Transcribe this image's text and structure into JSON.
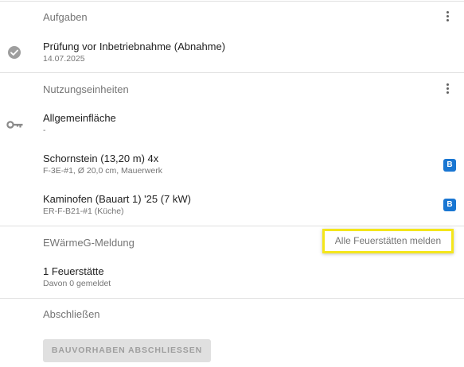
{
  "tasks": {
    "title": "Aufgaben",
    "item": {
      "title": "Prüfung vor Inbetriebnahme (Abnahme)",
      "date": "14.07.2025"
    }
  },
  "units": {
    "title": "Nutzungseinheiten",
    "area": {
      "title": "Allgemeinfläche",
      "subtitle": "-"
    },
    "items": [
      {
        "title": "Schornstein (13,20 m) 4x",
        "subtitle": "F-3E-#1, Ø 20,0 cm, Mauerwerk",
        "badge": "B"
      },
      {
        "title": "Kaminofen (Bauart 1) '25 (7 kW)",
        "subtitle": "ER-F-B21-#1 (Küche)",
        "badge": "B"
      }
    ]
  },
  "ewaermeg": {
    "title": "EWärmeG-Meldung",
    "report_all_label": "Alle Feuerstätten melden",
    "count_label": "1 Feuerstätte",
    "reported_label": "Davon 0 gemeldet"
  },
  "finish": {
    "title": "Abschließen",
    "button_label": "BAUVORHABEN ABSCHLIESSEN"
  },
  "colors": {
    "badge": "#1976d2",
    "highlight": "#f4e61b",
    "divider": "#e0e0e0"
  },
  "icons": {
    "task_status": "check-circle-icon",
    "units": "key-icon",
    "more": "more-vert-icon"
  }
}
